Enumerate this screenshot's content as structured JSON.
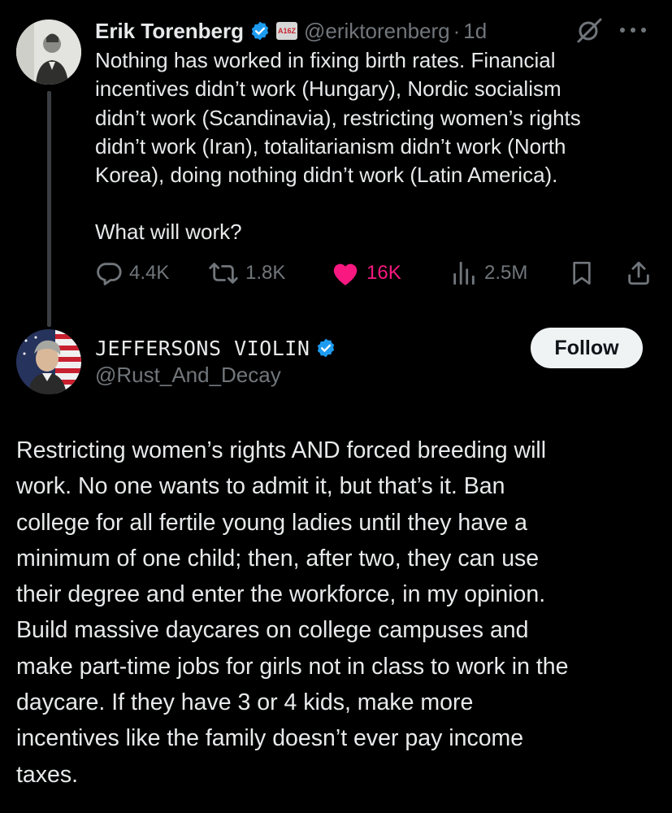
{
  "parent_tweet": {
    "author_name": "Erik Torenberg",
    "affiliate_badge": "A16Z",
    "handle": "@eriktorenberg",
    "separator": "·",
    "time": "1d",
    "body_lines": [
      "Nothing has worked in fixing birth rates. Financial",
      "incentives didn’t work (Hungary), Nordic socialism",
      "didn’t work (Scandinavia), restricting women’s rights",
      "didn’t work (Iran), totalitarianism didn’t work (North",
      "Korea), doing nothing didn’t work (Latin America)."
    ],
    "body_question": "What will work?",
    "stats": {
      "replies": "4.4K",
      "reposts": "1.8K",
      "likes": "16K",
      "views": "2.5M"
    }
  },
  "reply_tweet": {
    "author_name": "JEFFERSONS VIOLIN",
    "handle": "@Rust_And_Decay",
    "follow_label": "Follow",
    "body_lines": [
      "Restricting women’s rights AND forced breeding will",
      "work. No one wants to admit it, but that’s it. Ban",
      "college for all fertile young ladies until they have a",
      "minimum of one child; then, after two, they can use",
      "their degree and enter the workforce, in my opinion.",
      "Build massive daycares on college campuses and",
      "make part-time jobs for girls not in class to work in the",
      "daycare. If they have 3 or 4 kids, make more",
      "incentives like the family doesn’t ever pay income",
      "taxes."
    ]
  },
  "colors": {
    "background": "#000000",
    "text": "#e7e9ea",
    "muted": "#71767b",
    "verified": "#1d9bf0",
    "like": "#f91880",
    "follow_bg": "#eff3f4"
  }
}
